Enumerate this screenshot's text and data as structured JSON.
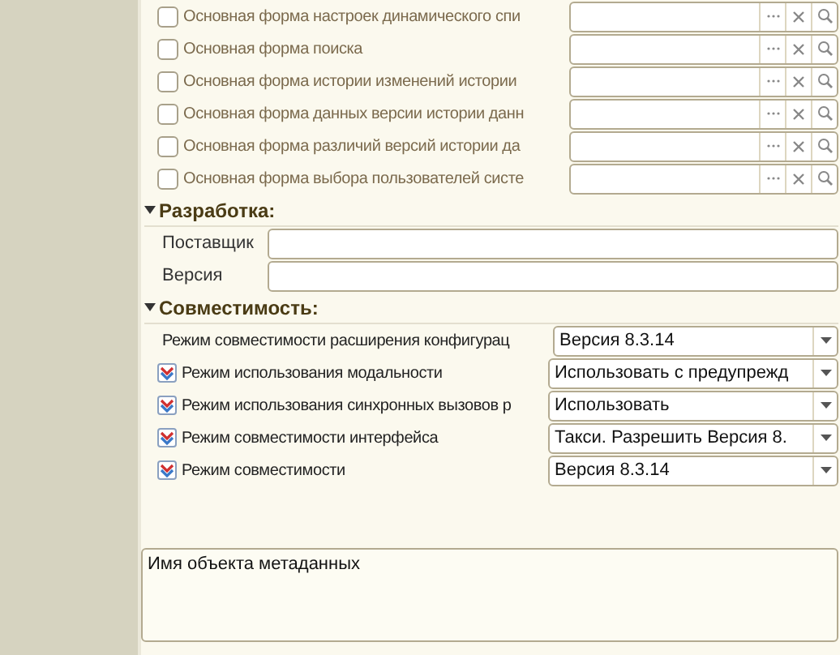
{
  "forms": [
    {
      "label": "Основная форма настроек динамического спи",
      "checked": false
    },
    {
      "label": "Основная форма поиска",
      "checked": false
    },
    {
      "label": "Основная форма истории изменений истории",
      "checked": false
    },
    {
      "label": "Основная форма данных версии истории данн",
      "checked": false
    },
    {
      "label": "Основная форма различий версий истории да",
      "checked": false
    },
    {
      "label": "Основная форма выбора пользователей систе",
      "checked": false
    }
  ],
  "development": {
    "title": "Разработка:",
    "expanded": true,
    "fields": [
      {
        "label": "Поставщик"
      },
      {
        "label": "Версия"
      }
    ]
  },
  "compatibility": {
    "title": "Совместимость:",
    "expanded": true,
    "rows": [
      {
        "kind": "plain",
        "label": "Режим совместимости расширения конфигурац",
        "value": "Версия 8.3.14"
      },
      {
        "kind": "checkbox",
        "checked": true,
        "label": "Режим использования модальности",
        "value": "Использовать с предупрежд"
      },
      {
        "kind": "checkbox",
        "checked": true,
        "label": "Режим использования синхронных вызовов р",
        "value": "Использовать"
      },
      {
        "kind": "checkbox",
        "checked": true,
        "label": "Режим совместимости интерфейса",
        "value": "Такси. Разрешить Версия 8."
      },
      {
        "kind": "checkbox",
        "checked": true,
        "label": "Режим совместимости",
        "value": "Версия 8.3.14"
      }
    ]
  },
  "description": {
    "text": "Имя объекта метаданных"
  }
}
